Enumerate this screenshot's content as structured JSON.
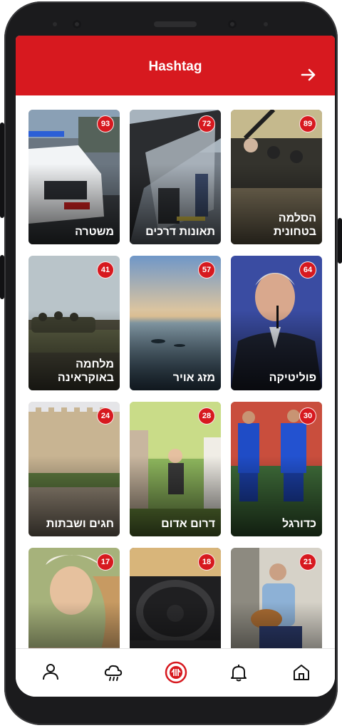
{
  "header": {
    "title": "Hashtag",
    "forward_icon": "arrow-right-icon"
  },
  "theme": {
    "accent": "#d7191f"
  },
  "tiles": [
    {
      "label": "הסלמה בטחונית",
      "count": "89"
    },
    {
      "label": "תאונות דרכים",
      "count": "72"
    },
    {
      "label": "משטרה",
      "count": "93"
    },
    {
      "label": "פוליטיקה",
      "count": "64"
    },
    {
      "label": "מזג אויר",
      "count": "57"
    },
    {
      "label": "מלחמה באוקראינה",
      "count": "41"
    },
    {
      "label": "כדורגל",
      "count": "30"
    },
    {
      "label": "דרום אדום",
      "count": "28"
    },
    {
      "label": "חגים ושבתות",
      "count": "24"
    },
    {
      "label": "",
      "count": "21"
    },
    {
      "label": "",
      "count": "18"
    },
    {
      "label": "",
      "count": "17"
    }
  ],
  "bottom_nav": {
    "items": [
      "home-icon",
      "bell-icon",
      "radio-icon",
      "weather-icon",
      "user-icon"
    ],
    "active": "radio-icon"
  }
}
